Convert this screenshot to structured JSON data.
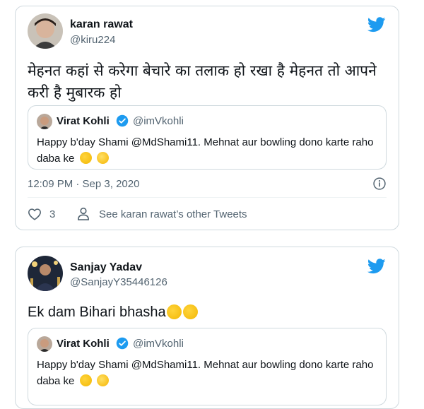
{
  "tweets": [
    {
      "author_name": "karan rawat",
      "author_handle": "@kiru224",
      "text": "मेहनत कहां से करेगा बेचारे का तलाक हो रखा है मेहनत तो आपने करी है मुबारक हो",
      "quote": {
        "author_name": "Virat Kohli",
        "author_handle": "@imVkohli",
        "text": "Happy b'day Shami @MdShami11. Mehnat aur bowling dono karte raho daba ke"
      },
      "timestamp": "12:09 PM · Sep 3, 2020",
      "like_count": "3",
      "other_tweets_label": "See karan rawat’s other Tweets"
    },
    {
      "author_name": "Sanjay Yadav",
      "author_handle": "@SanjayY35446126",
      "text": "Ek dam Bihari bhasha",
      "quote": {
        "author_name": "Virat Kohli",
        "author_handle": "@imVkohli",
        "text": "Happy b'day Shami @MdShami11. Mehnat aur bowling dono karte raho daba ke"
      }
    }
  ],
  "icons": {
    "brand_bird": "twitter-bird-icon",
    "verified": "verified-badge-icon",
    "info": "info-icon",
    "like": "heart-icon",
    "profile": "person-icon"
  },
  "colors": {
    "twitter_blue": "#1d9bf0",
    "border": "#cfd9de",
    "secondary_text": "#536471"
  }
}
